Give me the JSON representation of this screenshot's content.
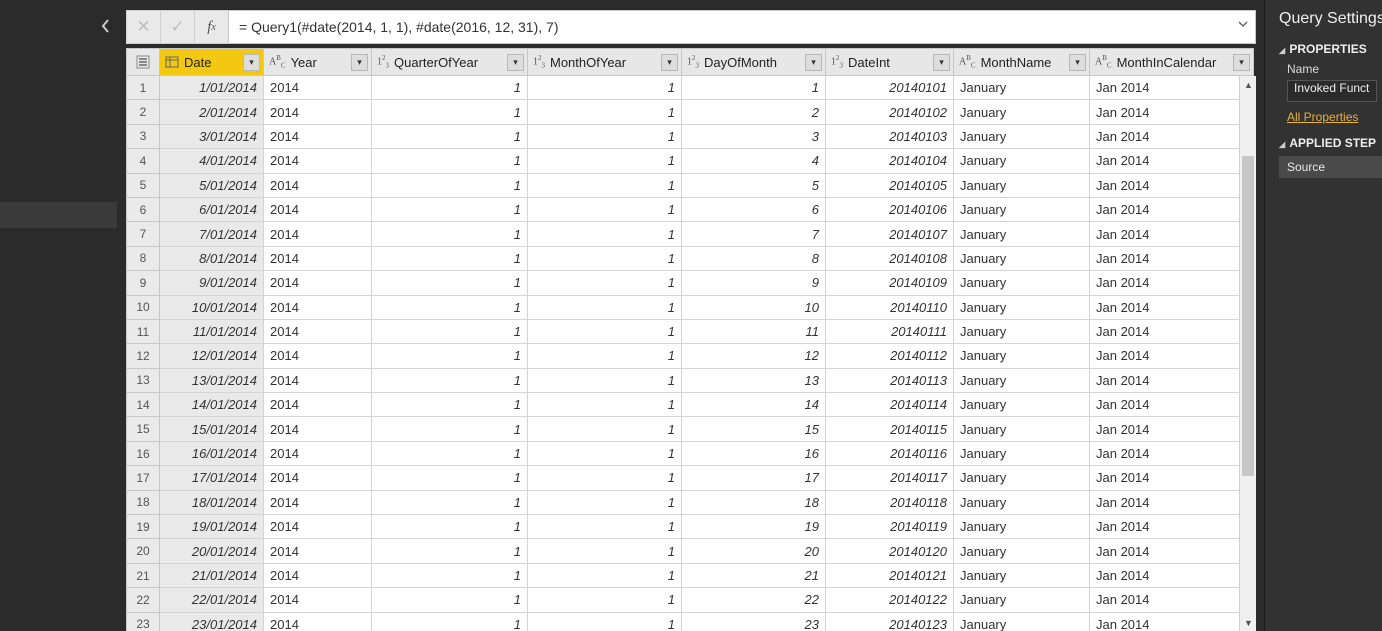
{
  "formula": {
    "text": "= Query1(#date(2014, 1, 1), #date(2016, 12, 31), 7)"
  },
  "rightPane": {
    "title": "Query Settings",
    "propertiesHeader": "PROPERTIES",
    "nameLabel": "Name",
    "nameValue": "Invoked Funct",
    "allPropsLink": "All Properties",
    "appliedHeader": "APPLIED STEP",
    "step1": "Source"
  },
  "columns": [
    {
      "key": "Date",
      "label": "Date",
      "type": "table",
      "w": "w-date",
      "align": "date-c",
      "sel": true
    },
    {
      "key": "Year",
      "label": "Year",
      "type": "abc",
      "w": "w-year",
      "align": "txt"
    },
    {
      "key": "QuarterOfYear",
      "label": "QuarterOfYear",
      "type": "123",
      "w": "w-q",
      "align": "num"
    },
    {
      "key": "MonthOfYear",
      "label": "MonthOfYear",
      "type": "123",
      "w": "w-m",
      "align": "num"
    },
    {
      "key": "DayOfMonth",
      "label": "DayOfMonth",
      "type": "123",
      "w": "w-d",
      "align": "num"
    },
    {
      "key": "DateInt",
      "label": "DateInt",
      "type": "123",
      "w": "w-di",
      "align": "num"
    },
    {
      "key": "MonthName",
      "label": "MonthName",
      "type": "abc",
      "w": "w-mn",
      "align": "txt"
    },
    {
      "key": "MonthInCalendar",
      "label": "MonthInCalendar",
      "type": "abc",
      "w": "w-mc",
      "align": "txt"
    }
  ],
  "rows": [
    {
      "n": 1,
      "Date": "1/01/2014",
      "Year": "2014",
      "QuarterOfYear": "1",
      "MonthOfYear": "1",
      "DayOfMonth": "1",
      "DateInt": "20140101",
      "MonthName": "January",
      "MonthInCalendar": "Jan 2014"
    },
    {
      "n": 2,
      "Date": "2/01/2014",
      "Year": "2014",
      "QuarterOfYear": "1",
      "MonthOfYear": "1",
      "DayOfMonth": "2",
      "DateInt": "20140102",
      "MonthName": "January",
      "MonthInCalendar": "Jan 2014"
    },
    {
      "n": 3,
      "Date": "3/01/2014",
      "Year": "2014",
      "QuarterOfYear": "1",
      "MonthOfYear": "1",
      "DayOfMonth": "3",
      "DateInt": "20140103",
      "MonthName": "January",
      "MonthInCalendar": "Jan 2014"
    },
    {
      "n": 4,
      "Date": "4/01/2014",
      "Year": "2014",
      "QuarterOfYear": "1",
      "MonthOfYear": "1",
      "DayOfMonth": "4",
      "DateInt": "20140104",
      "MonthName": "January",
      "MonthInCalendar": "Jan 2014"
    },
    {
      "n": 5,
      "Date": "5/01/2014",
      "Year": "2014",
      "QuarterOfYear": "1",
      "MonthOfYear": "1",
      "DayOfMonth": "5",
      "DateInt": "20140105",
      "MonthName": "January",
      "MonthInCalendar": "Jan 2014"
    },
    {
      "n": 6,
      "Date": "6/01/2014",
      "Year": "2014",
      "QuarterOfYear": "1",
      "MonthOfYear": "1",
      "DayOfMonth": "6",
      "DateInt": "20140106",
      "MonthName": "January",
      "MonthInCalendar": "Jan 2014"
    },
    {
      "n": 7,
      "Date": "7/01/2014",
      "Year": "2014",
      "QuarterOfYear": "1",
      "MonthOfYear": "1",
      "DayOfMonth": "7",
      "DateInt": "20140107",
      "MonthName": "January",
      "MonthInCalendar": "Jan 2014"
    },
    {
      "n": 8,
      "Date": "8/01/2014",
      "Year": "2014",
      "QuarterOfYear": "1",
      "MonthOfYear": "1",
      "DayOfMonth": "8",
      "DateInt": "20140108",
      "MonthName": "January",
      "MonthInCalendar": "Jan 2014"
    },
    {
      "n": 9,
      "Date": "9/01/2014",
      "Year": "2014",
      "QuarterOfYear": "1",
      "MonthOfYear": "1",
      "DayOfMonth": "9",
      "DateInt": "20140109",
      "MonthName": "January",
      "MonthInCalendar": "Jan 2014"
    },
    {
      "n": 10,
      "Date": "10/01/2014",
      "Year": "2014",
      "QuarterOfYear": "1",
      "MonthOfYear": "1",
      "DayOfMonth": "10",
      "DateInt": "20140110",
      "MonthName": "January",
      "MonthInCalendar": "Jan 2014"
    },
    {
      "n": 11,
      "Date": "11/01/2014",
      "Year": "2014",
      "QuarterOfYear": "1",
      "MonthOfYear": "1",
      "DayOfMonth": "11",
      "DateInt": "20140111",
      "MonthName": "January",
      "MonthInCalendar": "Jan 2014"
    },
    {
      "n": 12,
      "Date": "12/01/2014",
      "Year": "2014",
      "QuarterOfYear": "1",
      "MonthOfYear": "1",
      "DayOfMonth": "12",
      "DateInt": "20140112",
      "MonthName": "January",
      "MonthInCalendar": "Jan 2014"
    },
    {
      "n": 13,
      "Date": "13/01/2014",
      "Year": "2014",
      "QuarterOfYear": "1",
      "MonthOfYear": "1",
      "DayOfMonth": "13",
      "DateInt": "20140113",
      "MonthName": "January",
      "MonthInCalendar": "Jan 2014"
    },
    {
      "n": 14,
      "Date": "14/01/2014",
      "Year": "2014",
      "QuarterOfYear": "1",
      "MonthOfYear": "1",
      "DayOfMonth": "14",
      "DateInt": "20140114",
      "MonthName": "January",
      "MonthInCalendar": "Jan 2014"
    },
    {
      "n": 15,
      "Date": "15/01/2014",
      "Year": "2014",
      "QuarterOfYear": "1",
      "MonthOfYear": "1",
      "DayOfMonth": "15",
      "DateInt": "20140115",
      "MonthName": "January",
      "MonthInCalendar": "Jan 2014"
    },
    {
      "n": 16,
      "Date": "16/01/2014",
      "Year": "2014",
      "QuarterOfYear": "1",
      "MonthOfYear": "1",
      "DayOfMonth": "16",
      "DateInt": "20140116",
      "MonthName": "January",
      "MonthInCalendar": "Jan 2014"
    },
    {
      "n": 17,
      "Date": "17/01/2014",
      "Year": "2014",
      "QuarterOfYear": "1",
      "MonthOfYear": "1",
      "DayOfMonth": "17",
      "DateInt": "20140117",
      "MonthName": "January",
      "MonthInCalendar": "Jan 2014"
    },
    {
      "n": 18,
      "Date": "18/01/2014",
      "Year": "2014",
      "QuarterOfYear": "1",
      "MonthOfYear": "1",
      "DayOfMonth": "18",
      "DateInt": "20140118",
      "MonthName": "January",
      "MonthInCalendar": "Jan 2014"
    },
    {
      "n": 19,
      "Date": "19/01/2014",
      "Year": "2014",
      "QuarterOfYear": "1",
      "MonthOfYear": "1",
      "DayOfMonth": "19",
      "DateInt": "20140119",
      "MonthName": "January",
      "MonthInCalendar": "Jan 2014"
    },
    {
      "n": 20,
      "Date": "20/01/2014",
      "Year": "2014",
      "QuarterOfYear": "1",
      "MonthOfYear": "1",
      "DayOfMonth": "20",
      "DateInt": "20140120",
      "MonthName": "January",
      "MonthInCalendar": "Jan 2014"
    },
    {
      "n": 21,
      "Date": "21/01/2014",
      "Year": "2014",
      "QuarterOfYear": "1",
      "MonthOfYear": "1",
      "DayOfMonth": "21",
      "DateInt": "20140121",
      "MonthName": "January",
      "MonthInCalendar": "Jan 2014"
    },
    {
      "n": 22,
      "Date": "22/01/2014",
      "Year": "2014",
      "QuarterOfYear": "1",
      "MonthOfYear": "1",
      "DayOfMonth": "22",
      "DateInt": "20140122",
      "MonthName": "January",
      "MonthInCalendar": "Jan 2014"
    },
    {
      "n": 23,
      "Date": "23/01/2014",
      "Year": "2014",
      "QuarterOfYear": "1",
      "MonthOfYear": "1",
      "DayOfMonth": "23",
      "DateInt": "20140123",
      "MonthName": "January",
      "MonthInCalendar": "Jan 2014"
    }
  ]
}
